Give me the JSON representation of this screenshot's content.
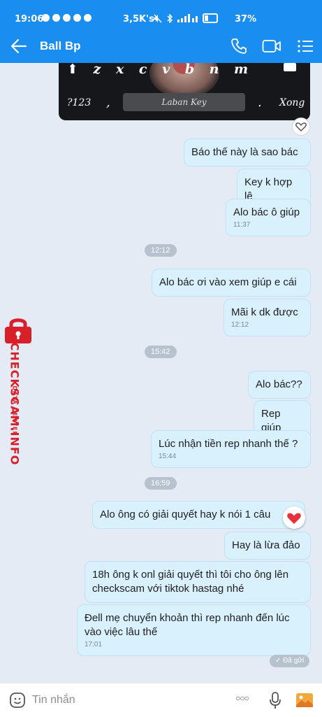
{
  "status_bar": {
    "time": "19:06",
    "network_speed": "3,5K's",
    "battery": "37%"
  },
  "header": {
    "contact_name": "Ball Bp",
    "icons": [
      "back-arrow-icon",
      "phone-icon",
      "video-call-icon",
      "menu-icon"
    ]
  },
  "keyboard_image": {
    "top_keys": "⬆ z x c v b n m",
    "num_key": "?123",
    "space_label": "Laban Key",
    "done_key": "Xong"
  },
  "watermark": {
    "line1": "DATA CENTER",
    "line2": "CHECKSCAM.INFO"
  },
  "messages": [
    {
      "text": "Báo thế này là sao bác"
    },
    {
      "text": "Key k hợp lệ"
    },
    {
      "text": "Alo bác ô giúp",
      "time": "11:37"
    },
    {
      "separator": "12:12"
    },
    {
      "text": "Alo bác ơi vào xem giúp e cái"
    },
    {
      "text": "Mãi k dk được",
      "time": "12:12"
    },
    {
      "separator": "15:42"
    },
    {
      "text": "Alo bác??"
    },
    {
      "text": "Rep giúp"
    },
    {
      "text": "Lúc nhận tiền rep nhanh thế ?",
      "time": "15:44"
    },
    {
      "separator": "16:59"
    },
    {
      "text": "Alo ông có giải quyết hay k nói 1 câu"
    },
    {
      "text": "Hay là lừa đảo"
    },
    {
      "text": "18h ông k onl giải quyết thì tôi cho ông lên checkscam với tiktok hastag nhé"
    },
    {
      "text": "Đell mẹ chuyển khoản thì rep nhanh đến lúc vào việc lâu thế",
      "time": "17:01"
    }
  ],
  "sent_status": "✓ Đã gửi",
  "composer": {
    "placeholder": "Tin nhắn",
    "more_label": "○○○"
  },
  "colors": {
    "header": "#1a8df0",
    "bubble": "#d9f0fd",
    "background": "#e4ebf4",
    "watermark": "#d81f2a"
  }
}
